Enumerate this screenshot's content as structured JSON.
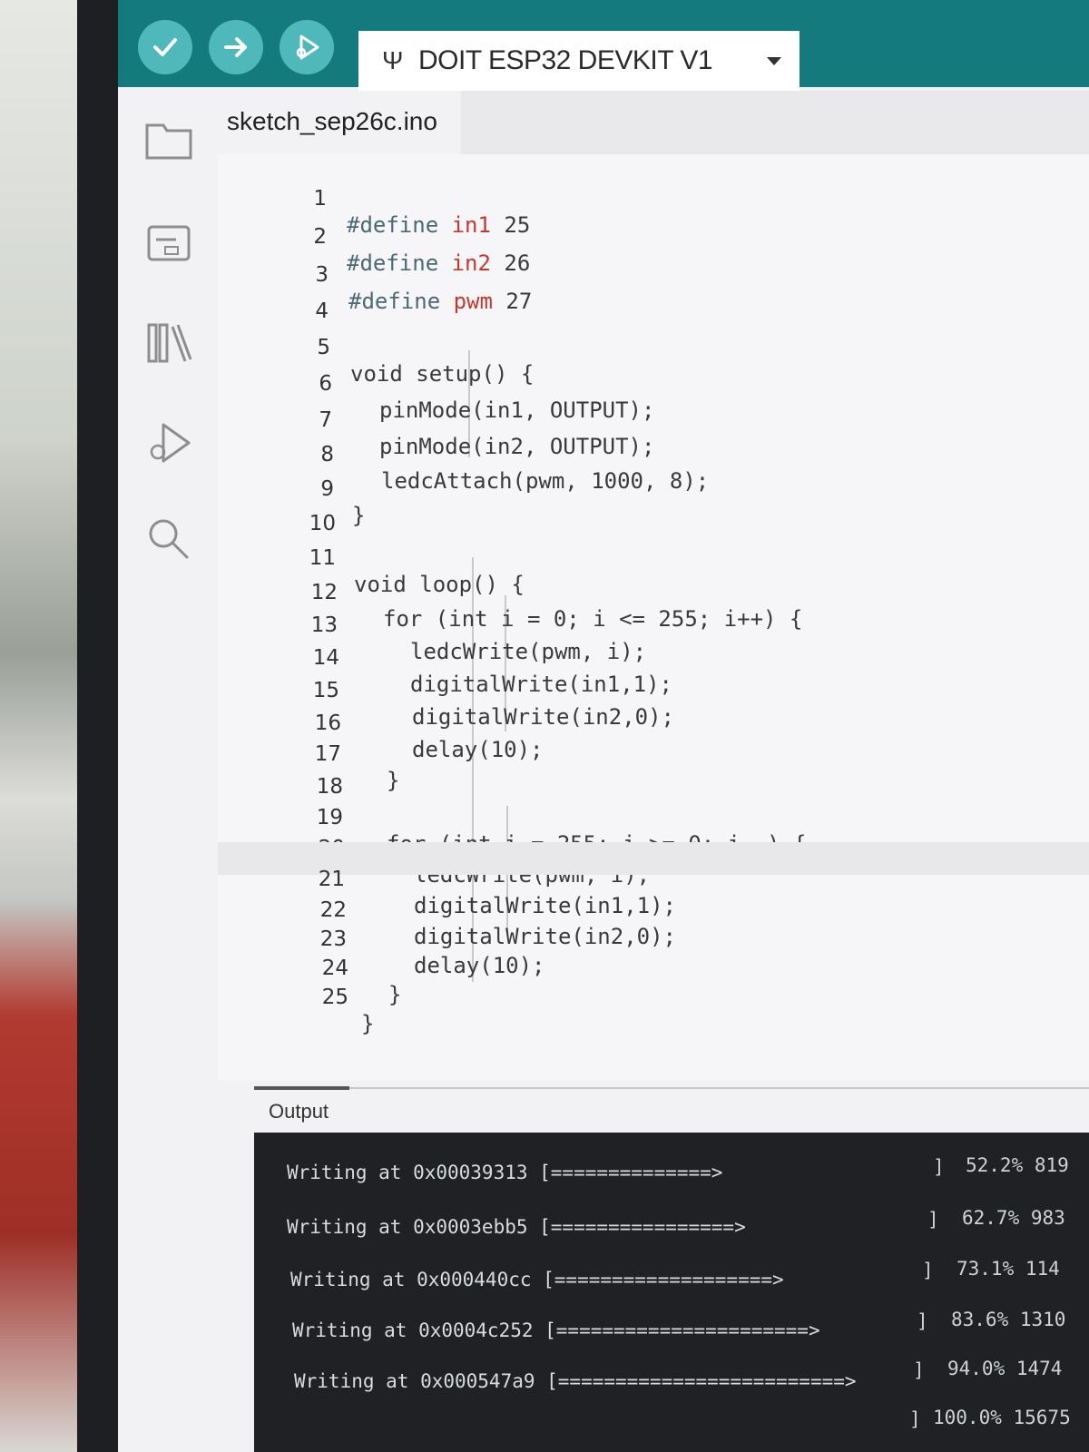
{
  "toolbar": {
    "verify_icon": "check-icon",
    "upload_icon": "arrow-right-icon",
    "debug_icon": "debug-play-icon",
    "board_usb_icon": "Ψ",
    "board_name": "DOIT ESP32 DEVKIT V1",
    "accent": "#157a7e",
    "button_color": "#4fb8ba"
  },
  "sidebar": {
    "items": [
      {
        "icon": "folder-icon"
      },
      {
        "icon": "board-manager-icon"
      },
      {
        "icon": "library-icon"
      },
      {
        "icon": "debug-icon"
      },
      {
        "icon": "search-icon"
      }
    ]
  },
  "tab": {
    "filename": "sketch_sep26c.ino"
  },
  "editor": {
    "lines": [
      {
        "n": "1",
        "text": "#define in1 25"
      },
      {
        "n": "2",
        "text": "#define in2 26"
      },
      {
        "n": "3",
        "text": "#define pwm 27"
      },
      {
        "n": "4",
        "text": ""
      },
      {
        "n": "5",
        "text": "void setup() {"
      },
      {
        "n": "6",
        "text": "pinMode(in1, OUTPUT);"
      },
      {
        "n": "7",
        "text": "pinMode(in2, OUTPUT);"
      },
      {
        "n": "8",
        "text": "ledcAttach(pwm, 1000, 8);"
      },
      {
        "n": "9",
        "text": "}"
      },
      {
        "n": "10",
        "text": ""
      },
      {
        "n": "11",
        "text": "void loop() {"
      },
      {
        "n": "12",
        "text": "for (int i = 0; i <= 255; i++) {"
      },
      {
        "n": "13",
        "text": "ledcWrite(pwm, i);"
      },
      {
        "n": "14",
        "text": "digitalWrite(in1,1);"
      },
      {
        "n": "15",
        "text": "digitalWrite(in2,0);"
      },
      {
        "n": "16",
        "text": "delay(10);"
      },
      {
        "n": "17",
        "text": "}"
      },
      {
        "n": "18",
        "text": ""
      },
      {
        "n": "19",
        "text": "for (int i = 255; i >= 0; i--) {"
      },
      {
        "n": "20",
        "text": "ledcWrite(pwm, i);"
      },
      {
        "n": "21",
        "text": "digitalWrite(in1,1);"
      },
      {
        "n": "22",
        "text": "digitalWrite(in2,0);"
      },
      {
        "n": "23",
        "text": "delay(10);"
      },
      {
        "n": "24",
        "text": "}"
      },
      {
        "n": "25",
        "text": "}"
      }
    ]
  },
  "output": {
    "label": "Output",
    "lines": [
      {
        "addr": "Writing at 0x00039313 [==============>",
        "close": "]",
        "pct": "52.2% 819"
      },
      {
        "addr": "Writing at 0x0003ebb5 [================>",
        "close": "]",
        "pct": "62.7% 983"
      },
      {
        "addr": "Writing at 0x000440cc [===================>",
        "close": "]",
        "pct": "73.1% 114"
      },
      {
        "addr": "Writing at 0x0004c252 [======================>",
        "close": "]",
        "pct": "83.6% 1310"
      },
      {
        "addr": "Writing at 0x000547a9 [=========================>",
        "close": "]",
        "pct": "94.0% 1474"
      },
      {
        "addr": "",
        "close": "]",
        "pct": "100.0% 15675"
      }
    ]
  }
}
